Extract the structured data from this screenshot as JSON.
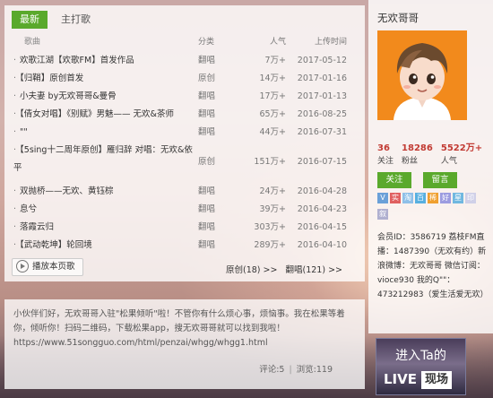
{
  "tabs": [
    {
      "label": "最新"
    },
    {
      "label": "主打歌"
    }
  ],
  "columns": {
    "title": "歌曲",
    "category": "分类",
    "popularity": "人气",
    "date": "上传时间"
  },
  "songs": [
    {
      "title": "欢歌江湖【欢歌FM】首发作品",
      "category": "翻唱",
      "popularity": "7万+",
      "date": "2017-05-12"
    },
    {
      "title": "【归鞘】原创首发",
      "category": "原创",
      "popularity": "14万+",
      "date": "2017-01-16"
    },
    {
      "title": "小夫妻 by无欢哥哥&曼骨",
      "category": "翻唱",
      "popularity": "17万+",
      "date": "2017-01-13"
    },
    {
      "title": "【倩女对唱】《别赋》男魅—— 无欢&茶师",
      "category": "翻唱",
      "popularity": "65万+",
      "date": "2016-08-25"
    },
    {
      "title": "\"\"",
      "category": "翻唱",
      "popularity": "44万+",
      "date": "2016-07-31"
    },
    {
      "title": "【5sing十二周年原创】雁归辞 对唱：无欢&依平",
      "category": "原创",
      "popularity": "151万+",
      "date": "2016-07-15"
    },
    {
      "title": "双抛桥——无欢、黄钰棕",
      "category": "翻唱",
      "popularity": "24万+",
      "date": "2016-04-28"
    },
    {
      "title": "息兮",
      "category": "翻唱",
      "popularity": "39万+",
      "date": "2016-04-23"
    },
    {
      "title": "落霞云归",
      "category": "翻唱",
      "popularity": "303万+",
      "date": "2016-04-15"
    },
    {
      "title": "【武动乾坤】轮回境",
      "category": "翻唱",
      "popularity": "289万+",
      "date": "2016-04-10"
    }
  ],
  "play_all_label": "播放本页歌",
  "pager": {
    "original": "原创(18) >>",
    "cover": "翻唱(121) >>"
  },
  "message": {
    "line1": "小伙伴们好，无欢哥哥入驻\"松果倾听\"啦！不管你有什么烦心事，烦恼事。我在松果等着你，倾听你！扫码二维码，下载松果app，搜无欢哥哥就可以找到我啦！",
    "link": "https://www.51songguo.com/html/penzai/whgg/whgg1.html",
    "comments": "评论:5",
    "views": "浏览:119",
    "separator": "|"
  },
  "profile": {
    "name": "无欢哥哥",
    "stats": [
      {
        "num": "36",
        "label": "关注"
      },
      {
        "num": "18286",
        "label": "粉丝"
      },
      {
        "num": "5522万+",
        "label": "人气"
      }
    ],
    "follow_label": "关注",
    "message_label": "留言",
    "badges": [
      {
        "text": "V",
        "color": "#6aa0d8"
      },
      {
        "text": "实",
        "color": "#e06060"
      },
      {
        "text": "淘",
        "color": "#8fc0e8"
      },
      {
        "text": "百",
        "color": "#58b0e0"
      },
      {
        "text": "稀",
        "color": "#f0a030"
      },
      {
        "text": "好",
        "color": "#9c9ce0"
      },
      {
        "text": "星",
        "color": "#70b8e0"
      },
      {
        "text": "印",
        "color": "#d0d0e8"
      },
      {
        "text": "叙",
        "color": "#b0b0d0"
      }
    ],
    "info": "会员ID：3586719 荔枝FM直播：1487390（无欢有约）新浪微博：无欢哥哥 微信订阅：vioce930 我的Q\"\"：473212983（爱生活爱无欢）"
  },
  "live": {
    "line1": "进入Ta的",
    "live_text": "LIVE",
    "room_text": "现场"
  }
}
